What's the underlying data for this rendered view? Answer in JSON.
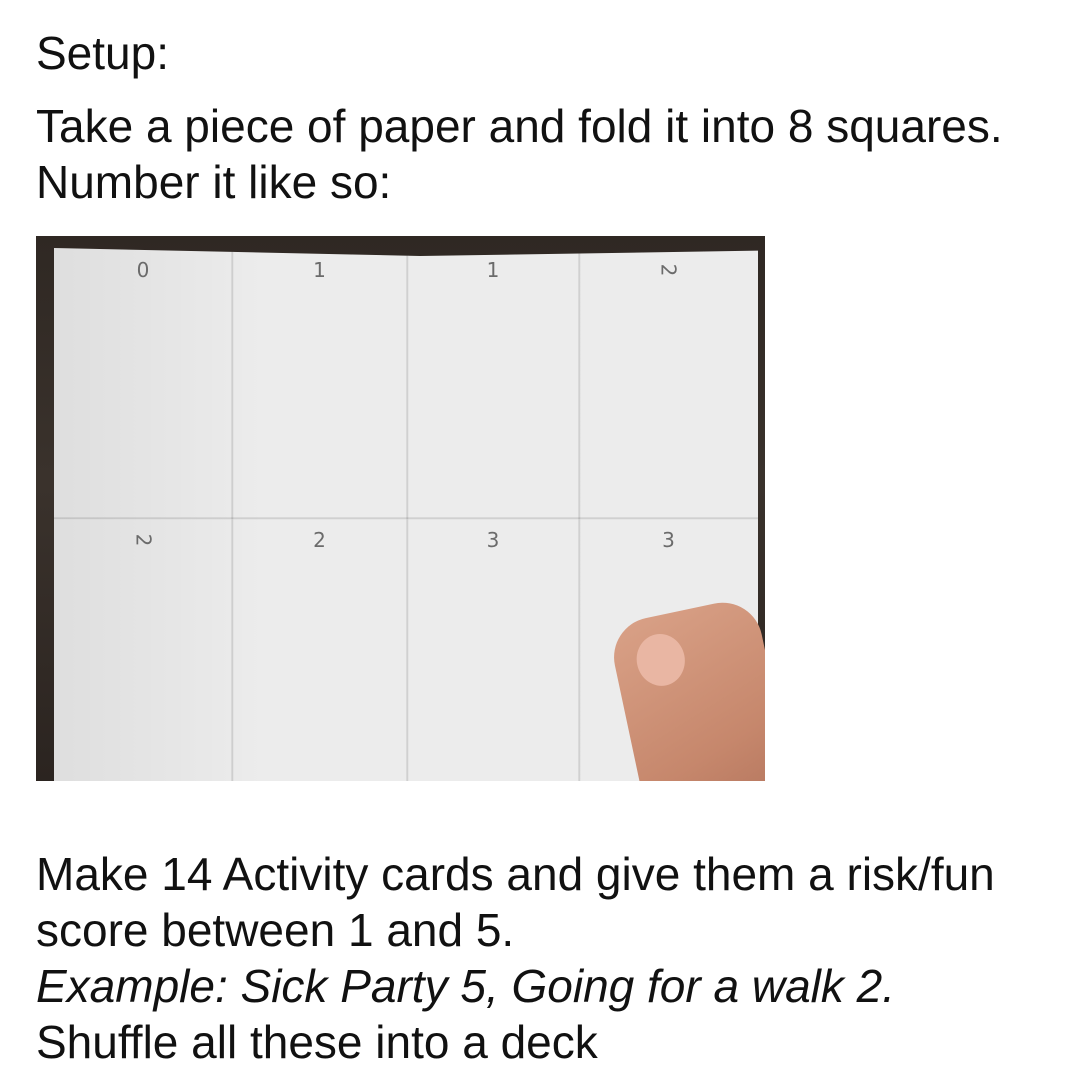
{
  "heading": "Setup:",
  "intro": "Take a piece of paper and fold it into 8 squares. Number it like so:",
  "photo": {
    "grid_top_labels": [
      "0",
      "1",
      "1",
      "2"
    ],
    "grid_bottom_labels": [
      "2",
      "2",
      "3",
      "3"
    ]
  },
  "instructions": {
    "line1": "Make 14 Activity cards and give them a risk/fun score between 1 and 5.",
    "example": "Example: Sick Party 5, Going for a walk 2.",
    "line2": " Shuffle all these into a deck"
  }
}
